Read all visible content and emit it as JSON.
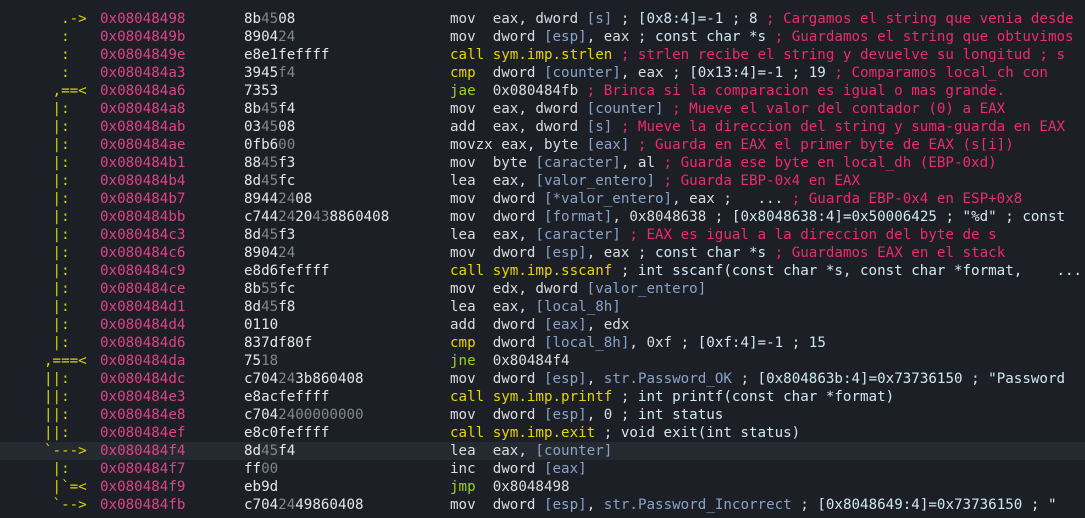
{
  "colors": {
    "background": "#1c2026",
    "highlight_row": "#252a30",
    "arrow": "#d7d700",
    "address": "#e0408a",
    "comment": "#ee2a6b",
    "variable": "#8aa2c8",
    "call_jmp_yellow": "#e8d400",
    "conditional_jump_green": "#9ad21e"
  },
  "rows": [
    {
      "arrows": "  .->",
      "addr": "0x08048498",
      "hex": [
        [
          "b",
          "8b"
        ],
        [
          "d",
          "45"
        ],
        [
          "b",
          "08"
        ]
      ],
      "instr": [
        [
          "t",
          "mov  eax, dword "
        ],
        [
          "v",
          "[s]"
        ],
        [
          "t",
          " ; "
        ],
        [
          "a",
          "[0x8:4]=-1 ; 8"
        ],
        [
          "c",
          " ; Cargamos el string que venia desde"
        ]
      ]
    },
    {
      "arrows": "  :  ",
      "addr": "0x0804849b",
      "hex": [
        [
          "b",
          "8904"
        ],
        [
          "d",
          "24"
        ]
      ],
      "instr": [
        [
          "t",
          "mov  dword "
        ],
        [
          "v",
          "[esp]"
        ],
        [
          "t",
          ", eax ; "
        ],
        [
          "a",
          "const char *s"
        ],
        [
          "c",
          " ; Guardamos el string que obtuvimos"
        ]
      ]
    },
    {
      "arrows": "  :  ",
      "addr": "0x0804849e",
      "hex": [
        [
          "b",
          "e8e1fe"
        ],
        [
          "b",
          "ffff"
        ]
      ],
      "instr": [
        [
          "y",
          "call sym.imp.strlen"
        ],
        [
          "c",
          " ; strlen recibe el string y devuelve su longitud ; s"
        ]
      ]
    },
    {
      "arrows": "  :  ",
      "addr": "0x080484a3",
      "hex": [
        [
          "b",
          "3945"
        ],
        [
          "d",
          "f4"
        ]
      ],
      "instr": [
        [
          "y",
          "cmp  "
        ],
        [
          "t",
          "dword "
        ],
        [
          "v",
          "[counter]"
        ],
        [
          "t",
          ", eax ; "
        ],
        [
          "a",
          "[0x13:4]=-1 ; 19"
        ],
        [
          "c",
          " ; Comparamos local_ch con"
        ]
      ]
    },
    {
      "arrows": " ,==<",
      "addr": "0x080484a6",
      "hex": [
        [
          "b",
          "7353"
        ]
      ],
      "instr": [
        [
          "g",
          "jae  "
        ],
        [
          "t",
          "0x080484fb"
        ],
        [
          "c",
          " ; Brinca si la comparacion es igual o mas grande."
        ]
      ]
    },
    {
      "arrows": " |:  ",
      "addr": "0x080484a8",
      "hex": [
        [
          "b",
          "8b"
        ],
        [
          "d",
          "45"
        ],
        [
          "b",
          "f4"
        ]
      ],
      "instr": [
        [
          "t",
          "mov  eax, dword "
        ],
        [
          "v",
          "[counter]"
        ],
        [
          "c",
          " ; Mueve el valor del contador (0) a EAX"
        ]
      ]
    },
    {
      "arrows": " |:  ",
      "addr": "0x080484ab",
      "hex": [
        [
          "b",
          "03"
        ],
        [
          "d",
          "45"
        ],
        [
          "b",
          "08"
        ]
      ],
      "instr": [
        [
          "t",
          "add  eax, dword "
        ],
        [
          "v",
          "[s]"
        ],
        [
          "c",
          " ; Mueve la direccion del string y suma-guarda en EAX"
        ]
      ]
    },
    {
      "arrows": " |:  ",
      "addr": "0x080484ae",
      "hex": [
        [
          "b",
          "0fb6"
        ],
        [
          "d",
          "00"
        ]
      ],
      "instr": [
        [
          "t",
          "movzx eax, byte "
        ],
        [
          "v",
          "[eax]"
        ],
        [
          "c",
          " ; Guarda en EAX el primer byte de EAX (s[i])"
        ]
      ]
    },
    {
      "arrows": " |:  ",
      "addr": "0x080484b1",
      "hex": [
        [
          "b",
          "88"
        ],
        [
          "d",
          "45"
        ],
        [
          "b",
          "f3"
        ]
      ],
      "instr": [
        [
          "t",
          "mov  byte "
        ],
        [
          "v",
          "[caracter]"
        ],
        [
          "t",
          ", al"
        ],
        [
          "c",
          " ; Guarda ese byte en local_dh (EBP-0xd)"
        ]
      ]
    },
    {
      "arrows": " |:  ",
      "addr": "0x080484b4",
      "hex": [
        [
          "b",
          "8d"
        ],
        [
          "d",
          "45"
        ],
        [
          "b",
          "fc"
        ]
      ],
      "instr": [
        [
          "t",
          "lea  eax, "
        ],
        [
          "v",
          "[valor_entero]"
        ],
        [
          "c",
          " ; Guarda EBP-0x4 en EAX"
        ]
      ]
    },
    {
      "arrows": " |:  ",
      "addr": "0x080484b7",
      "hex": [
        [
          "b",
          "8944"
        ],
        [
          "d",
          "24"
        ],
        [
          "b",
          "08"
        ]
      ],
      "instr": [
        [
          "t",
          "mov  dword "
        ],
        [
          "v",
          "[*valor_entero]"
        ],
        [
          "t",
          ", eax ;   "
        ],
        [
          "a",
          "..."
        ],
        [
          "c",
          " ; Guarda EBP-0x4 en ESP+0x8"
        ]
      ]
    },
    {
      "arrows": " |:  ",
      "addr": "0x080484bb",
      "hex": [
        [
          "b",
          "c744"
        ],
        [
          "d",
          "24"
        ],
        [
          "b",
          "20"
        ],
        [
          "d",
          "43"
        ],
        [
          "b",
          "8860408"
        ]
      ],
      "instr": [
        [
          "t",
          "mov  dword "
        ],
        [
          "v",
          "[format]"
        ],
        [
          "t",
          ", 0x8048638 ; "
        ],
        [
          "a",
          "[0x8048638:4]=0x50006425 ; \"%d\" ; const"
        ]
      ]
    },
    {
      "arrows": " |:  ",
      "addr": "0x080484c3",
      "hex": [
        [
          "b",
          "8d"
        ],
        [
          "d",
          "45"
        ],
        [
          "b",
          "f3"
        ]
      ],
      "instr": [
        [
          "t",
          "lea  eax, "
        ],
        [
          "v",
          "[caracter]"
        ],
        [
          "c",
          " ; EAX es igual a la direccion del byte de s"
        ]
      ]
    },
    {
      "arrows": " |:  ",
      "addr": "0x080484c6",
      "hex": [
        [
          "b",
          "8904"
        ],
        [
          "d",
          "24"
        ]
      ],
      "instr": [
        [
          "t",
          "mov  dword "
        ],
        [
          "v",
          "[esp]"
        ],
        [
          "t",
          ", eax ; "
        ],
        [
          "a",
          "const char *s"
        ],
        [
          "c",
          " ; Guardamos EAX en el stack"
        ]
      ]
    },
    {
      "arrows": " |:  ",
      "addr": "0x080484c9",
      "hex": [
        [
          "b",
          "e8d6fe"
        ],
        [
          "b",
          "ffff"
        ]
      ],
      "instr": [
        [
          "y",
          "call sym.imp.sscanf"
        ],
        [
          "t",
          " ; "
        ],
        [
          "a",
          "int sscanf(const char *s, const char *format,    ..."
        ]
      ]
    },
    {
      "arrows": " |:  ",
      "addr": "0x080484ce",
      "hex": [
        [
          "b",
          "8b"
        ],
        [
          "d",
          "55"
        ],
        [
          "b",
          "fc"
        ]
      ],
      "instr": [
        [
          "t",
          "mov  edx, dword "
        ],
        [
          "v",
          "[valor_entero]"
        ]
      ]
    },
    {
      "arrows": " |:  ",
      "addr": "0x080484d1",
      "hex": [
        [
          "b",
          "8d"
        ],
        [
          "d",
          "45"
        ],
        [
          "b",
          "f8"
        ]
      ],
      "instr": [
        [
          "t",
          "lea  eax, "
        ],
        [
          "v",
          "[local_8h]"
        ]
      ]
    },
    {
      "arrows": " |:  ",
      "addr": "0x080484d4",
      "hex": [
        [
          "b",
          "0110"
        ]
      ],
      "instr": [
        [
          "t",
          "add  dword "
        ],
        [
          "v",
          "[eax]"
        ],
        [
          "t",
          ", edx"
        ]
      ]
    },
    {
      "arrows": " |:  ",
      "addr": "0x080484d6",
      "hex": [
        [
          "b",
          "837df80f"
        ]
      ],
      "instr": [
        [
          "y",
          "cmp  "
        ],
        [
          "t",
          "dword "
        ],
        [
          "v",
          "[local_8h]"
        ],
        [
          "t",
          ", 0xf ; "
        ],
        [
          "a",
          "[0xf:4]=-1 ; 15"
        ]
      ]
    },
    {
      "arrows": ",===<",
      "addr": "0x080484da",
      "hex": [
        [
          "b",
          "75"
        ],
        [
          "d",
          "18"
        ]
      ],
      "instr": [
        [
          "g",
          "jne  "
        ],
        [
          "t",
          "0x80484f4"
        ]
      ]
    },
    {
      "arrows": "||:  ",
      "addr": "0x080484dc",
      "hex": [
        [
          "b",
          "c704"
        ],
        [
          "d",
          "24"
        ],
        [
          "b",
          "3b860408"
        ]
      ],
      "instr": [
        [
          "t",
          "mov  dword "
        ],
        [
          "v",
          "[esp]"
        ],
        [
          "t",
          ", "
        ],
        [
          "v",
          "str.Password_OK"
        ],
        [
          "t",
          " ; "
        ],
        [
          "a",
          "[0x804863b:4]=0x73736150 ; \"Password"
        ]
      ]
    },
    {
      "arrows": "||:  ",
      "addr": "0x080484e3",
      "hex": [
        [
          "b",
          "e8acfe"
        ],
        [
          "b",
          "ffff"
        ]
      ],
      "instr": [
        [
          "y",
          "call sym.imp.printf"
        ],
        [
          "t",
          " ; "
        ],
        [
          "a",
          "int printf(const char *format)"
        ]
      ]
    },
    {
      "arrows": "||:  ",
      "addr": "0x080484e8",
      "hex": [
        [
          "b",
          "c704"
        ],
        [
          "d",
          "24"
        ],
        [
          "d",
          "00000000"
        ]
      ],
      "instr": [
        [
          "t",
          "mov  dword "
        ],
        [
          "v",
          "[esp]"
        ],
        [
          "t",
          ", 0 ; "
        ],
        [
          "a",
          "int status"
        ]
      ]
    },
    {
      "arrows": "||:  ",
      "addr": "0x080484ef",
      "hex": [
        [
          "b",
          "e8c0fe"
        ],
        [
          "b",
          "ffff"
        ]
      ],
      "instr": [
        [
          "y",
          "call sym.imp.exit"
        ],
        [
          "t",
          " ; "
        ],
        [
          "a",
          "void exit(int status)"
        ]
      ]
    },
    {
      "arrows": "`--->",
      "addr": "0x080484f4",
      "hex": [
        [
          "b",
          "8d"
        ],
        [
          "d",
          "45"
        ],
        [
          "b",
          "f4"
        ]
      ],
      "instr": [
        [
          "t",
          "lea  eax, "
        ],
        [
          "v",
          "[counter]"
        ]
      ],
      "hl": true
    },
    {
      "arrows": " |:  ",
      "addr": "0x080484f7",
      "hex": [
        [
          "b",
          "ff"
        ],
        [
          "d",
          "00"
        ]
      ],
      "instr": [
        [
          "t",
          "inc  dword "
        ],
        [
          "v",
          "[eax]"
        ]
      ]
    },
    {
      "arrows": " |`=<",
      "addr": "0x080484f9",
      "hex": [
        [
          "b",
          "eb9d"
        ]
      ],
      "instr": [
        [
          "g",
          "jmp  "
        ],
        [
          "t",
          "0x8048498"
        ]
      ]
    },
    {
      "arrows": " `-->",
      "addr": "0x080484fb",
      "hex": [
        [
          "b",
          "c704"
        ],
        [
          "d",
          "24"
        ],
        [
          "b",
          "49860408"
        ]
      ],
      "instr": [
        [
          "t",
          "mov  dword "
        ],
        [
          "v",
          "[esp]"
        ],
        [
          "t",
          ", "
        ],
        [
          "v",
          "str.Password_Incorrect"
        ],
        [
          "t",
          " ; "
        ],
        [
          "a",
          "[0x8048649:4]=0x73736150 ; \""
        ]
      ]
    }
  ]
}
